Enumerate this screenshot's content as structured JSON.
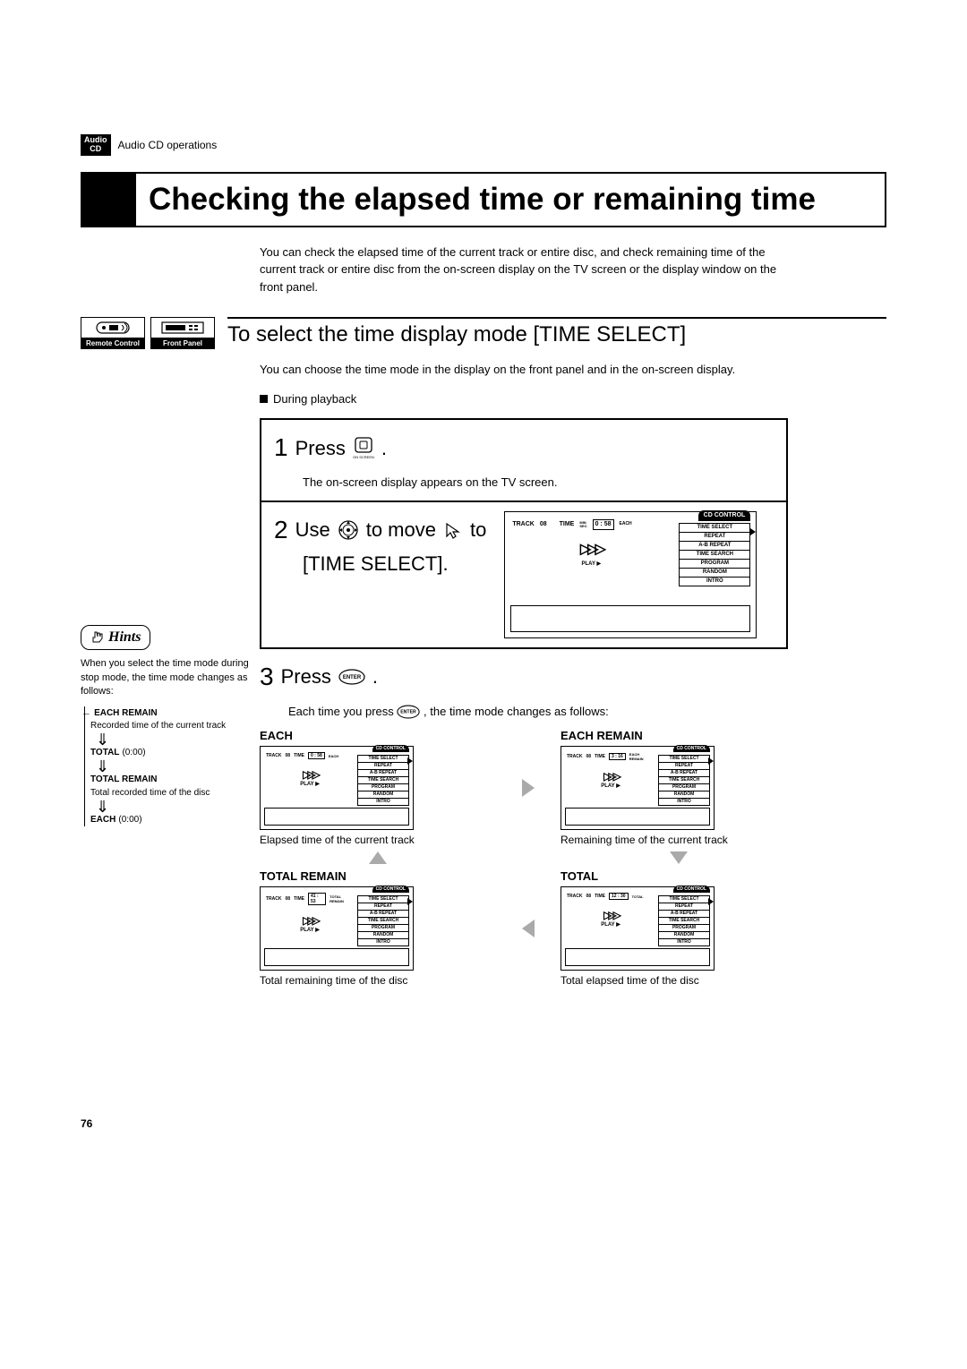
{
  "header": {
    "badge_line1": "Audio",
    "badge_line2": "CD",
    "breadcrumb": "Audio CD operations"
  },
  "title": "Checking the elapsed time or remaining time",
  "intro": "You can check the elapsed time of the current track or entire disc, and check remaining time of the current track or entire disc from the on-screen display on the TV screen or the display window on the front panel.",
  "devices": {
    "remote": "Remote Control",
    "front": "Front Panel"
  },
  "section_title": "To select the time display mode [TIME SELECT]",
  "section_intro": "You can choose the time mode in the display on the front panel and in the on-screen display.",
  "condition": "During playback",
  "step1": {
    "num": "1",
    "text_a": "Press",
    "text_b": ".",
    "btn_sub": "ON SCREEN",
    "desc": "The on-screen display appears on the TV screen."
  },
  "step2": {
    "num": "2",
    "text_a": "Use",
    "text_b": "to move",
    "text_c": "to",
    "text_d": "[TIME SELECT]."
  },
  "step3": {
    "num": "3",
    "text_a": "Press",
    "text_b": ".",
    "btn_label": "ENTER",
    "desc_a": "Each time you press",
    "desc_b": ", the time mode changes as follows:"
  },
  "osd": {
    "tab": "CD CONTROL",
    "menu": [
      "TIME SELECT",
      "REPEAT",
      "A-B REPEAT",
      "TIME SEARCH",
      "PROGRAM",
      "RANDOM",
      "INTRO"
    ],
    "track_label": "TRACK",
    "time_label": "TIME",
    "min_label": "MIN",
    "sec_label": "SEC",
    "play_label": "PLAY ▶"
  },
  "modes": {
    "each": {
      "title": "EACH",
      "track": "08",
      "time": "0 : 58",
      "badge": "EACH",
      "caption": "Elapsed time of the current track"
    },
    "each_remain": {
      "title": "EACH REMAIN",
      "track": "08",
      "time": "3 : 16",
      "badge": "EACH REMAIN",
      "caption": "Remaining time of the current track"
    },
    "total_remain": {
      "title": "TOTAL REMAIN",
      "track": "08",
      "time": "41 : 53",
      "badge": "TOTAL REMAIN",
      "caption": "Total remaining time of the disc"
    },
    "total": {
      "title": "TOTAL",
      "track": "08",
      "time": "12 : 30",
      "badge": "TOTAL",
      "caption": "Total elapsed time of the disc"
    }
  },
  "large_osd": {
    "track": "08",
    "time": "0 : 58",
    "badge": "EACH"
  },
  "hints": {
    "label": "Hints",
    "intro": "When you select the time mode during stop mode, the time mode changes as follows:",
    "items": [
      {
        "bold": "EACH REMAIN",
        "sub": "Recorded time of the current track"
      },
      {
        "bold": "TOTAL",
        "sub": "(0:00)"
      },
      {
        "bold": "TOTAL REMAIN",
        "sub": "Total recorded time of the disc"
      },
      {
        "bold": "EACH",
        "sub": "(0:00)"
      }
    ]
  },
  "page_number": "76"
}
